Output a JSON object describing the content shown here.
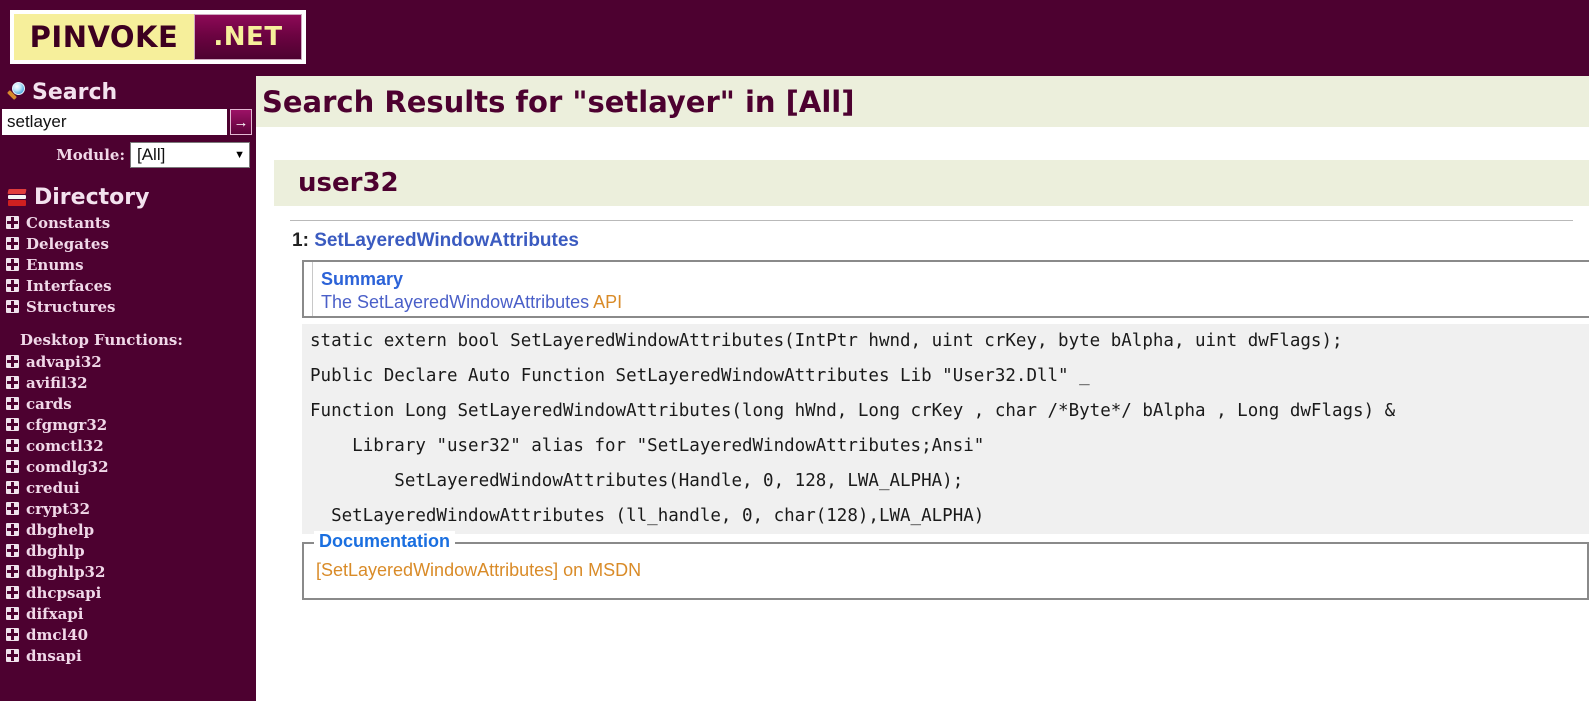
{
  "brand": {
    "name_left": "PINVOKE",
    "name_right": ".NET",
    "bar_color": "#4d0130",
    "logo_yellow": "#f6ef9b"
  },
  "sidebar": {
    "search": {
      "heading": "Search",
      "icon": "magnifier-icon",
      "input_value": "setlayer",
      "input_placeholder": "",
      "go_label": "→",
      "module_label": "Module:",
      "module_value": "[All]",
      "module_arrow": "▼"
    },
    "directory": {
      "heading": "Directory",
      "icon": "books-icon",
      "items": [
        {
          "label": "Constants"
        },
        {
          "label": "Delegates"
        },
        {
          "label": "Enums"
        },
        {
          "label": "Interfaces"
        },
        {
          "label": "Structures"
        }
      ],
      "group_label": "Desktop Functions:",
      "modules": [
        {
          "label": "advapi32"
        },
        {
          "label": "avifil32"
        },
        {
          "label": "cards"
        },
        {
          "label": "cfgmgr32"
        },
        {
          "label": "comctl32"
        },
        {
          "label": "comdlg32"
        },
        {
          "label": "credui"
        },
        {
          "label": "crypt32"
        },
        {
          "label": "dbghelp"
        },
        {
          "label": "dbghlp"
        },
        {
          "label": "dbghlp32"
        },
        {
          "label": "dhcpsapi"
        },
        {
          "label": "difxapi"
        },
        {
          "label": "dmcl40"
        },
        {
          "label": "dnsapi"
        }
      ]
    }
  },
  "main": {
    "page_title": "Search Results for \"setlayer\" in [All]",
    "module_section": {
      "title": "user32"
    },
    "result": {
      "index": "1:",
      "name": "SetLayeredWindowAttributes",
      "summary": {
        "legend": "Summary",
        "text_prefix": "The SetLayeredWindowAttributes ",
        "text_api": "API"
      },
      "code_lines": [
        {
          "text": "static extern bool SetLayeredWindowAttributes(IntPtr hwnd, uint crKey, byte bAlpha, uint dwFlags);",
          "alt": true
        },
        {
          "text": "Public Declare Auto Function SetLayeredWindowAttributes Lib \"User32.Dll\" _",
          "alt": true
        },
        {
          "text": "Function Long SetLayeredWindowAttributes(long hWnd, Long crKey , char /*Byte*/ bAlpha , Long dwFlags) &",
          "alt": true
        },
        {
          "text": "    Library \"user32\" alias for \"SetLayeredWindowAttributes;Ansi\"",
          "alt": true
        },
        {
          "text": "        SetLayeredWindowAttributes(Handle, 0, 128, LWA_ALPHA);",
          "alt": true
        },
        {
          "text": "  SetLayeredWindowAttributes (ll_handle, 0, char(128),LWA_ALPHA)",
          "alt": true
        }
      ],
      "documentation": {
        "legend": "Documentation",
        "link": "[SetLayeredWindowAttributes] on MSDN"
      }
    }
  },
  "colors": {
    "brand_maroon": "#4d0130",
    "band_green": "#ecefdc",
    "code_alt": "#f0f0f0",
    "link_blue": "#3b5bc0",
    "accent_orange": "#d98b28"
  }
}
